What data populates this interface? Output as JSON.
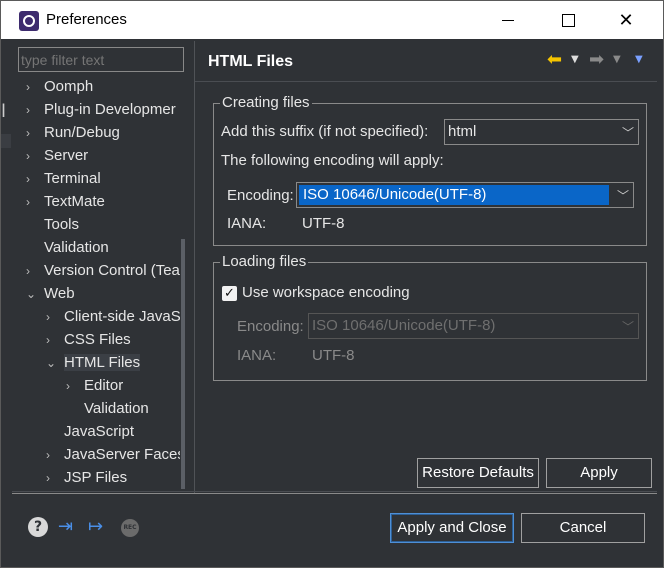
{
  "window": {
    "title": "Preferences"
  },
  "filter": {
    "placeholder": "type filter text"
  },
  "tree": [
    {
      "label": "Oomph",
      "arrow": "›",
      "depth": 0
    },
    {
      "label": "Plug-in Developmer",
      "arrow": "›",
      "depth": 0
    },
    {
      "label": "Run/Debug",
      "arrow": "›",
      "depth": 0
    },
    {
      "label": "Server",
      "arrow": "›",
      "depth": 0
    },
    {
      "label": "Terminal",
      "arrow": "›",
      "depth": 0
    },
    {
      "label": "TextMate",
      "arrow": "›",
      "depth": 0
    },
    {
      "label": "Tools",
      "arrow": "",
      "depth": 0
    },
    {
      "label": "Validation",
      "arrow": "",
      "depth": 0
    },
    {
      "label": "Version Control (Tea",
      "arrow": "›",
      "depth": 0
    },
    {
      "label": "Web",
      "arrow": "⌄",
      "depth": 0
    },
    {
      "label": "Client-side JavaS",
      "arrow": "›",
      "depth": 1
    },
    {
      "label": "CSS Files",
      "arrow": "›",
      "depth": 1
    },
    {
      "label": "HTML Files",
      "arrow": "⌄",
      "depth": 1,
      "selected": true
    },
    {
      "label": "Editor",
      "arrow": "›",
      "depth": 2
    },
    {
      "label": "Validation",
      "arrow": "",
      "depth": 2
    },
    {
      "label": "JavaScript",
      "arrow": "",
      "depth": 1
    },
    {
      "label": "JavaServer Faces",
      "arrow": "›",
      "depth": 1
    },
    {
      "label": "JSP Files",
      "arrow": "›",
      "depth": 1
    }
  ],
  "page": {
    "title": "HTML Files",
    "creating": {
      "legend": "Creating files",
      "suffix_label": "Add this suffix (if not specified):",
      "suffix_value": "html",
      "encoding_note": "The following encoding will apply:",
      "encoding_label": "Encoding:",
      "encoding_value": "ISO 10646/Unicode(UTF-8)",
      "iana_label": "IANA:",
      "iana_value": "UTF-8"
    },
    "loading": {
      "legend": "Loading files",
      "checkbox_label": "Use workspace encoding",
      "checkbox_checked": true,
      "encoding_label": "Encoding:",
      "encoding_value": "ISO 10646/Unicode(UTF-8)",
      "iana_label": "IANA:",
      "iana_value": "UTF-8"
    }
  },
  "buttons": {
    "restore": "Restore Defaults",
    "apply": "Apply",
    "apply_close": "Apply and Close",
    "cancel": "Cancel"
  },
  "footer_icons": {
    "help": "?",
    "rec": "REC"
  },
  "colors": {
    "selection": "#0a66c8",
    "back_arrow": "#f5c400",
    "footer_icon": "#4a8fe8"
  }
}
